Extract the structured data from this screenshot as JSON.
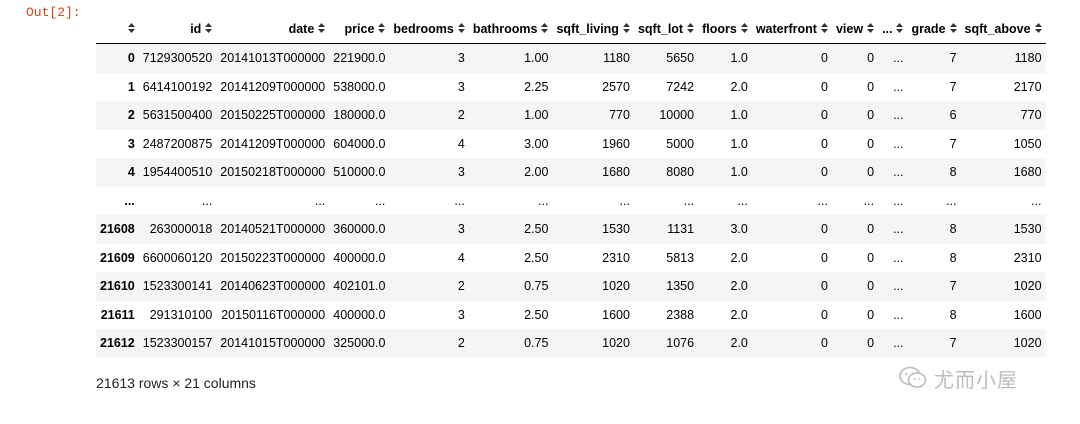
{
  "prompt": "Out[2]:",
  "columns": [
    "",
    "id",
    "date",
    "price",
    "bedrooms",
    "bathrooms",
    "sqft_living",
    "sqft_lot",
    "floors",
    "waterfront",
    "view",
    "...",
    "grade",
    "sqft_above"
  ],
  "rows": [
    [
      "0",
      "7129300520",
      "20141013T000000",
      "221900.0",
      "3",
      "1.00",
      "1180",
      "5650",
      "1.0",
      "0",
      "0",
      "...",
      "7",
      "1180"
    ],
    [
      "1",
      "6414100192",
      "20141209T000000",
      "538000.0",
      "3",
      "2.25",
      "2570",
      "7242",
      "2.0",
      "0",
      "0",
      "...",
      "7",
      "2170"
    ],
    [
      "2",
      "5631500400",
      "20150225T000000",
      "180000.0",
      "2",
      "1.00",
      "770",
      "10000",
      "1.0",
      "0",
      "0",
      "...",
      "6",
      "770"
    ],
    [
      "3",
      "2487200875",
      "20141209T000000",
      "604000.0",
      "4",
      "3.00",
      "1960",
      "5000",
      "1.0",
      "0",
      "0",
      "...",
      "7",
      "1050"
    ],
    [
      "4",
      "1954400510",
      "20150218T000000",
      "510000.0",
      "3",
      "2.00",
      "1680",
      "8080",
      "1.0",
      "0",
      "0",
      "...",
      "8",
      "1680"
    ],
    [
      "...",
      "...",
      "...",
      "...",
      "...",
      "...",
      "...",
      "...",
      "...",
      "...",
      "...",
      "...",
      "...",
      "..."
    ],
    [
      "21608",
      "263000018",
      "20140521T000000",
      "360000.0",
      "3",
      "2.50",
      "1530",
      "1131",
      "3.0",
      "0",
      "0",
      "...",
      "8",
      "1530"
    ],
    [
      "21609",
      "6600060120",
      "20150223T000000",
      "400000.0",
      "4",
      "2.50",
      "2310",
      "5813",
      "2.0",
      "0",
      "0",
      "...",
      "8",
      "2310"
    ],
    [
      "21610",
      "1523300141",
      "20140623T000000",
      "402101.0",
      "2",
      "0.75",
      "1020",
      "1350",
      "2.0",
      "0",
      "0",
      "...",
      "7",
      "1020"
    ],
    [
      "21611",
      "291310100",
      "20150116T000000",
      "400000.0",
      "3",
      "2.50",
      "1600",
      "2388",
      "2.0",
      "0",
      "0",
      "...",
      "8",
      "1600"
    ],
    [
      "21612",
      "1523300157",
      "20141015T000000",
      "325000.0",
      "2",
      "0.75",
      "1020",
      "1076",
      "2.0",
      "0",
      "0",
      "...",
      "7",
      "1020"
    ]
  ],
  "shape_text": "21613 rows × 21 columns",
  "watermark": "尤而小屋",
  "colors": {
    "prompt": "#d84315",
    "stripe": "#f5f5f5",
    "watermark": "#bdbdbd"
  }
}
